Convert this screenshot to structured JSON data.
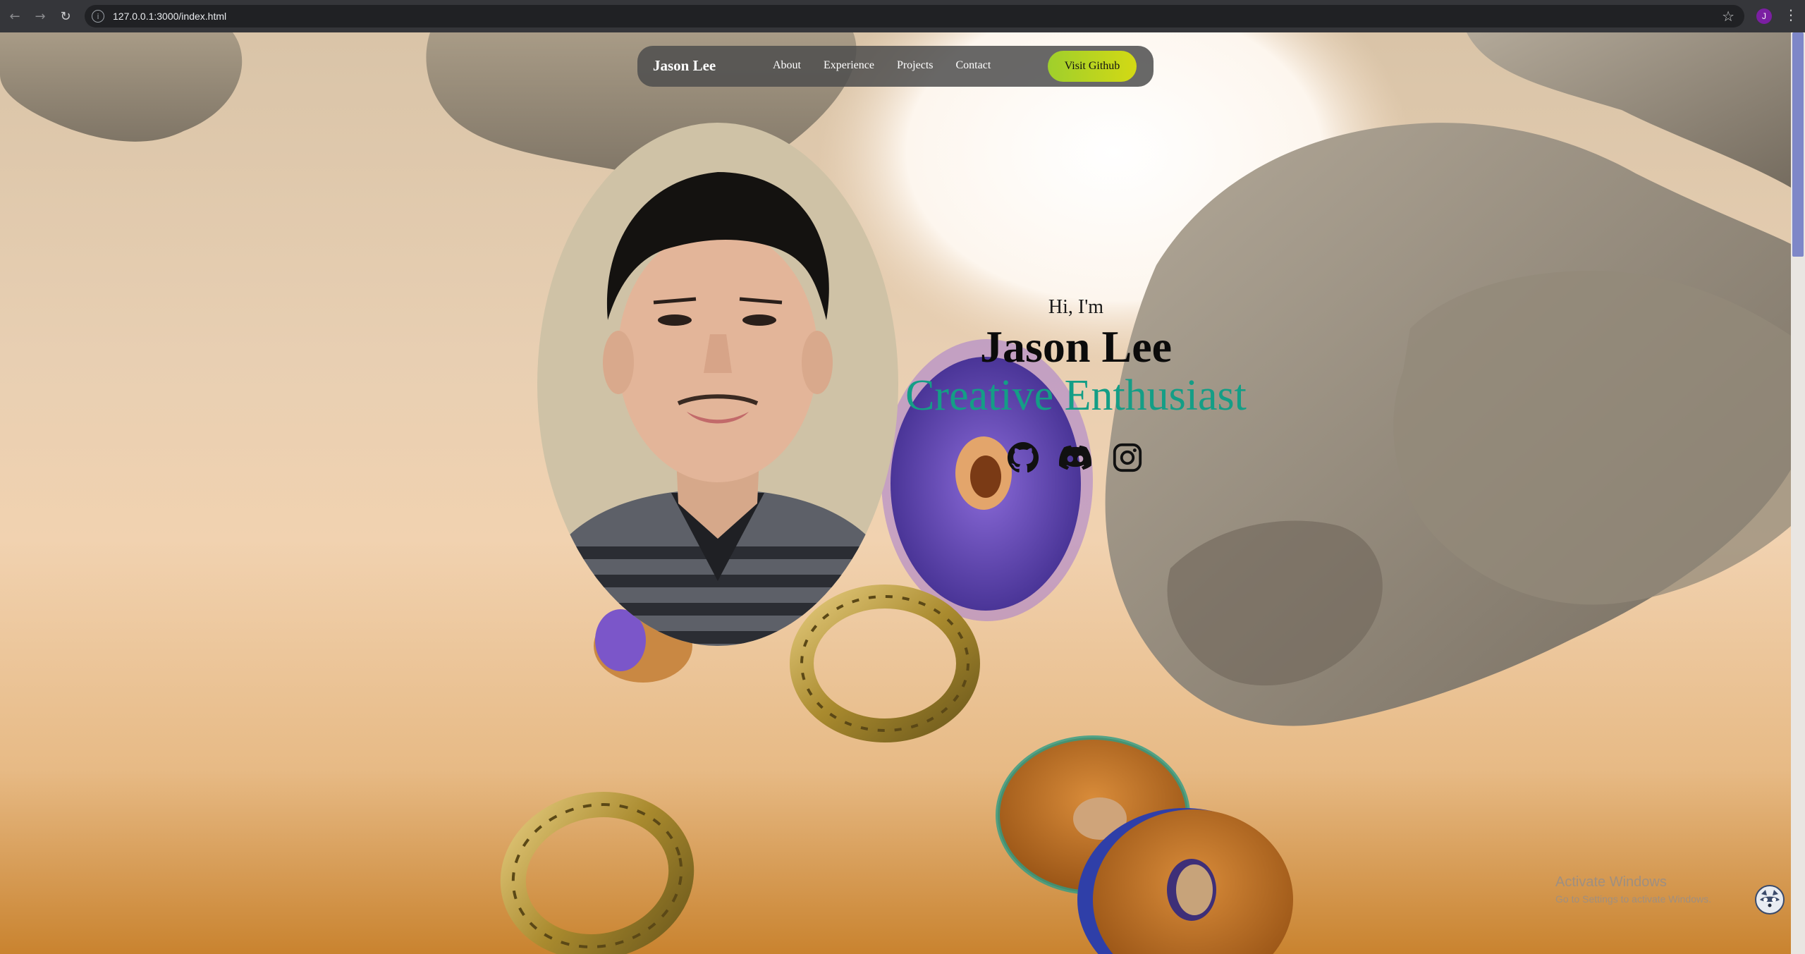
{
  "browser": {
    "url": "127.0.0.1:3000/index.html",
    "profile_initial": "J",
    "back_icon": "arrow-left-icon",
    "forward_icon": "arrow-right-icon",
    "reload_icon": "reload-icon",
    "info_icon": "info-icon",
    "bookmark_icon": "star-icon",
    "menu_icon": "kebab-menu-icon"
  },
  "navbar": {
    "brand": "Jason Lee",
    "links": [
      "About",
      "Experience",
      "Projects",
      "Contact"
    ],
    "cta_label": "Visit Github"
  },
  "hero": {
    "greeting": "Hi, I'm",
    "name": "Jason Lee",
    "role": "Creative Enthusiast",
    "role_color": "#149e86",
    "socials": [
      "github-icon",
      "discord-icon",
      "instagram-icon"
    ]
  },
  "os_watermark": {
    "title": "Activate Windows",
    "subtitle": "Go to Settings to activate Windows."
  },
  "colors": {
    "cta_start": "#9fcf2c",
    "cta_end": "#d3d914",
    "navbar_bg": "#4e4e4e",
    "scroll_thumb": "#7e87c8"
  }
}
